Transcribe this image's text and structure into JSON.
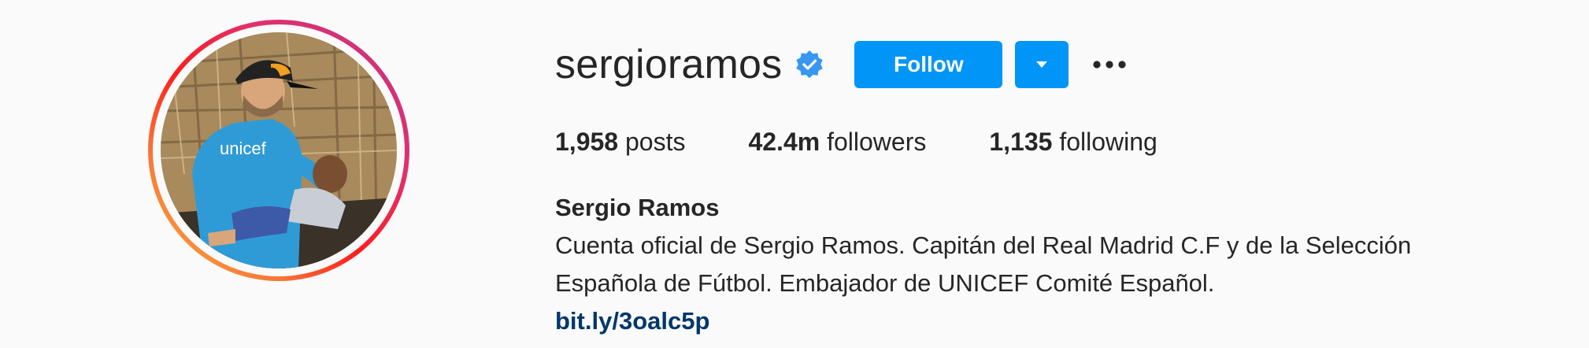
{
  "profile": {
    "username": "sergioramos",
    "verified_icon": "verified-badge-icon",
    "follow_label": "Follow",
    "dropdown_icon": "caret-down-icon",
    "more_icon": "ellipsis-icon",
    "avatar_icon": "profile-photo"
  },
  "stats": {
    "posts_count": "1,958",
    "posts_label": "posts",
    "followers_count": "42.4m",
    "followers_label": "followers",
    "following_count": "1,135",
    "following_label": "following"
  },
  "bio": {
    "full_name": "Sergio Ramos",
    "line1": "Cuenta oficial de Sergio Ramos. Capitán del Real Madrid C.F y de la Selección",
    "line2": "Española de Fútbol. Embajador de UNICEF Comité Español.",
    "link": "bit.ly/3oalc5p"
  },
  "colors": {
    "follow_blue": "#0095f6",
    "verified_blue": "#3897f0",
    "link_blue": "#00376b",
    "text": "#262626",
    "background": "#fafafa"
  }
}
